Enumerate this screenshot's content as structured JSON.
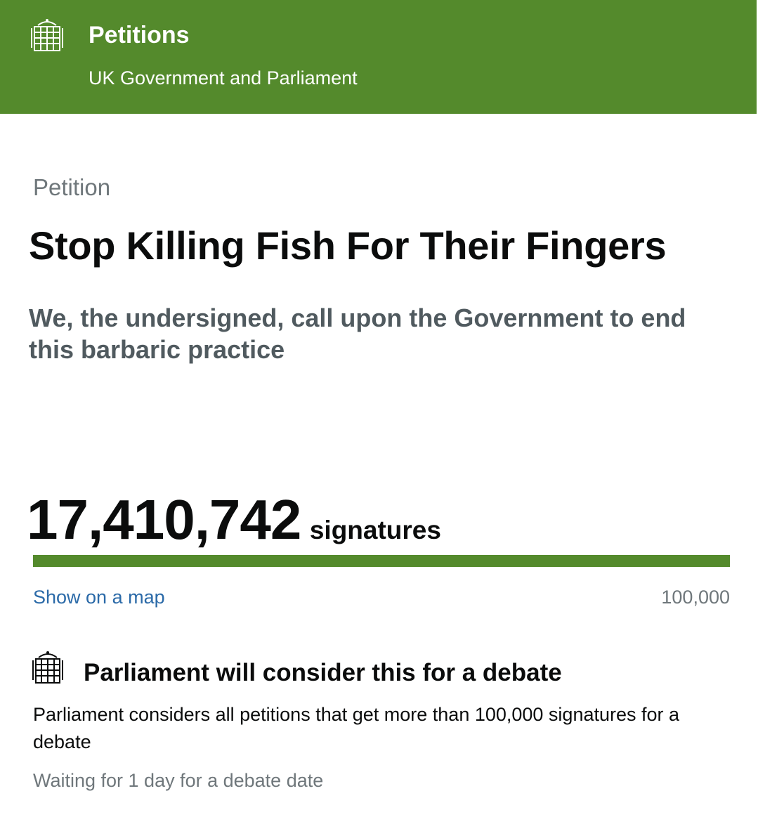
{
  "header": {
    "logo_icon": "portcullis-icon",
    "title": "Petitions",
    "subtitle": "UK Government and Parliament",
    "background_color": "#548a2c"
  },
  "petition": {
    "eyebrow": "Petition",
    "title": "Stop Killing Fish For Their Fingers",
    "action": "We, the undersigned, call upon the Government to end this barbaric practice"
  },
  "signatures": {
    "count": "17,410,742",
    "label": "signatures",
    "progress_fraction": 1.0,
    "map_link": "Show on a map",
    "threshold": "100,000"
  },
  "debate": {
    "icon": "portcullis-icon",
    "heading": "Parliament will consider this for a debate",
    "text": "Parliament considers all petitions that get more than 100,000 signatures for a debate",
    "waiting": "Waiting for 1 day for a debate date"
  },
  "colors": {
    "brand_green": "#548a2c",
    "link_blue": "#2b6aa8",
    "secondary_text": "#6f777b"
  }
}
